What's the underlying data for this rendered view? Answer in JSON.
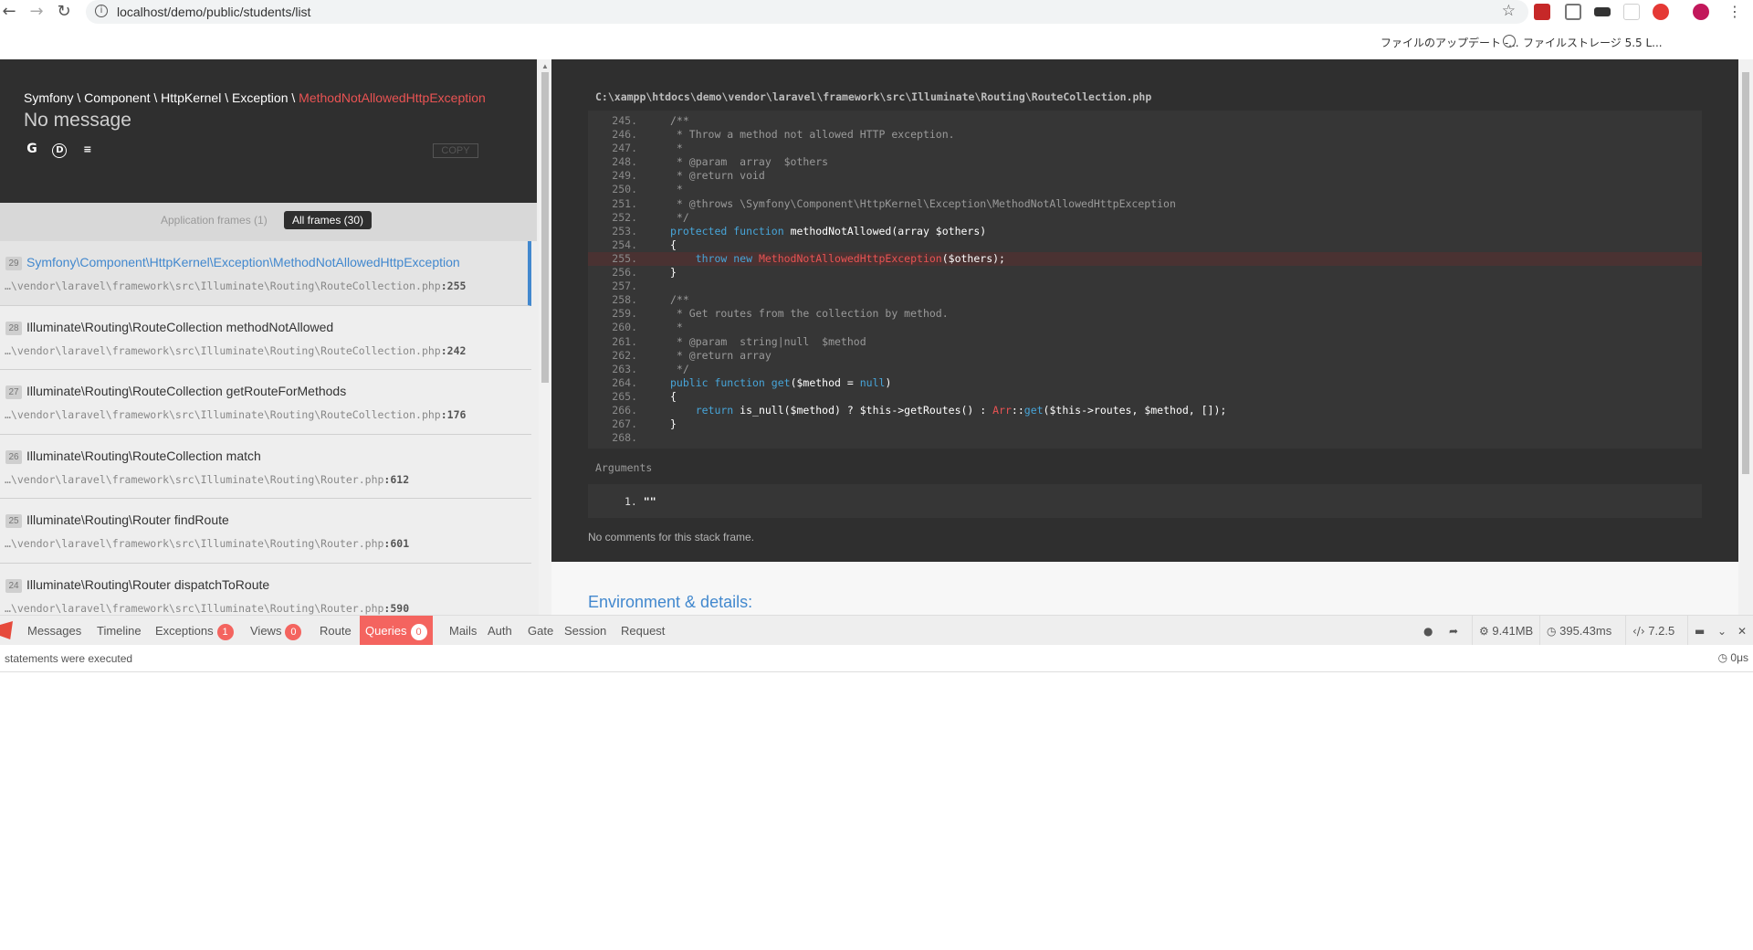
{
  "browser": {
    "url": "localhost/demo/public/students/list",
    "bookmarks": [
      "ファイルのアップデート -...",
      "ファイルストレージ 5.5 L..."
    ],
    "ext_colors": [
      "#c62828",
      "#777777",
      "#333333",
      "#cfcfcf",
      "#e53935",
      "#c2185b"
    ]
  },
  "exception": {
    "namespace": "Symfony \\ Component \\ HttpKernel \\ Exception \\ ",
    "class": "MethodNotAllowedHttpException",
    "message": "No message",
    "copy_label": "COPY",
    "icons": [
      "google-icon",
      "duckduckgo-icon",
      "stackoverflow-icon"
    ]
  },
  "tabs": {
    "app_frames": "Application frames (1)",
    "all_frames": "All frames (30)"
  },
  "frames": [
    {
      "idx": "29",
      "cls": "Symfony\\Component\\HttpKernel\\Exception\\MethodNotAllowedHttpException",
      "file": "…\\vendor\\laravel\\framework\\src\\Illuminate\\Routing\\RouteCollection.php",
      "line": ":255",
      "active": true
    },
    {
      "idx": "28",
      "cls": "Illuminate\\Routing\\RouteCollection methodNotAllowed",
      "file": "…\\vendor\\laravel\\framework\\src\\Illuminate\\Routing\\RouteCollection.php",
      "line": ":242",
      "active": false
    },
    {
      "idx": "27",
      "cls": "Illuminate\\Routing\\RouteCollection getRouteForMethods",
      "file": "…\\vendor\\laravel\\framework\\src\\Illuminate\\Routing\\RouteCollection.php",
      "line": ":176",
      "active": false
    },
    {
      "idx": "26",
      "cls": "Illuminate\\Routing\\RouteCollection match",
      "file": "…\\vendor\\laravel\\framework\\src\\Illuminate\\Routing\\Router.php",
      "line": ":612",
      "active": false
    },
    {
      "idx": "25",
      "cls": "Illuminate\\Routing\\Router findRoute",
      "file": "…\\vendor\\laravel\\framework\\src\\Illuminate\\Routing\\Router.php",
      "line": ":601",
      "active": false
    },
    {
      "idx": "24",
      "cls": "Illuminate\\Routing\\Router dispatchToRoute",
      "file": "…\\vendor\\laravel\\framework\\src\\Illuminate\\Routing\\Router.php",
      "line": ":590",
      "active": false
    }
  ],
  "code": {
    "file_path": "C:\\xampp\\htdocs\\demo\\vendor\\laravel\\framework\\src\\Illuminate\\Routing\\RouteCollection.php",
    "highlight_line": "255.",
    "lines": [
      {
        "n": "245.",
        "parts": [
          {
            "t": "/**",
            "c": "com"
          }
        ]
      },
      {
        "n": "246.",
        "parts": [
          {
            "t": " * Throw a method not allowed HTTP exception.",
            "c": "com"
          }
        ]
      },
      {
        "n": "247.",
        "parts": [
          {
            "t": " *",
            "c": "com"
          }
        ]
      },
      {
        "n": "248.",
        "parts": [
          {
            "t": " * @param  array  $others",
            "c": "com"
          }
        ]
      },
      {
        "n": "249.",
        "parts": [
          {
            "t": " * @return void",
            "c": "com"
          }
        ]
      },
      {
        "n": "250.",
        "parts": [
          {
            "t": " *",
            "c": "com"
          }
        ]
      },
      {
        "n": "251.",
        "parts": [
          {
            "t": " * @throws \\Symfony\\Component\\HttpKernel\\Exception\\MethodNotAllowedHttpException",
            "c": "com"
          }
        ]
      },
      {
        "n": "252.",
        "parts": [
          {
            "t": " */",
            "c": "com"
          }
        ]
      },
      {
        "n": "253.",
        "parts": [
          {
            "t": "protected function ",
            "c": "kw"
          },
          {
            "t": "methodNotAllowed(array $others)",
            "c": "fn"
          }
        ]
      },
      {
        "n": "254.",
        "parts": [
          {
            "t": "{",
            "c": "fn"
          }
        ]
      },
      {
        "n": "255.",
        "parts": [
          {
            "t": "    throw new ",
            "c": "kw"
          },
          {
            "t": "MethodNotAllowedHttpException",
            "c": "ex"
          },
          {
            "t": "($others);",
            "c": "fn"
          }
        ]
      },
      {
        "n": "256.",
        "parts": [
          {
            "t": "}",
            "c": "fn"
          }
        ]
      },
      {
        "n": "257.",
        "parts": []
      },
      {
        "n": "258.",
        "parts": [
          {
            "t": "/**",
            "c": "com"
          }
        ]
      },
      {
        "n": "259.",
        "parts": [
          {
            "t": " * Get routes from the collection by method.",
            "c": "com"
          }
        ]
      },
      {
        "n": "260.",
        "parts": [
          {
            "t": " *",
            "c": "com"
          }
        ]
      },
      {
        "n": "261.",
        "parts": [
          {
            "t": " * @param  string|null  $method",
            "c": "com"
          }
        ]
      },
      {
        "n": "262.",
        "parts": [
          {
            "t": " * @return array",
            "c": "com"
          }
        ]
      },
      {
        "n": "263.",
        "parts": [
          {
            "t": " */",
            "c": "com"
          }
        ]
      },
      {
        "n": "264.",
        "parts": [
          {
            "t": "public function ",
            "c": "kw"
          },
          {
            "t": "get",
            "c": "kw"
          },
          {
            "t": "($method = ",
            "c": "fn"
          },
          {
            "t": "null",
            "c": "kw"
          },
          {
            "t": ")",
            "c": "fn"
          }
        ]
      },
      {
        "n": "265.",
        "parts": [
          {
            "t": "{",
            "c": "fn"
          }
        ]
      },
      {
        "n": "266.",
        "parts": [
          {
            "t": "    return ",
            "c": "kw"
          },
          {
            "t": "is_null($method) ? $this->getRoutes() : ",
            "c": "fn"
          },
          {
            "t": "Arr",
            "c": "ex"
          },
          {
            "t": "::",
            "c": "fn"
          },
          {
            "t": "get",
            "c": "kw"
          },
          {
            "t": "($this->routes, $method, []);",
            "c": "fn"
          }
        ]
      },
      {
        "n": "267.",
        "parts": [
          {
            "t": "}",
            "c": "fn"
          }
        ]
      },
      {
        "n": "268.",
        "parts": []
      }
    ],
    "arguments_title": "Arguments",
    "argument_index": "1.",
    "argument_value": "\"\"",
    "no_comments": "No comments for this stack frame."
  },
  "environment_title": "Environment & details:",
  "debugbar": {
    "tabs": [
      {
        "label": "Messages",
        "badge": null,
        "active": false
      },
      {
        "label": "Timeline",
        "badge": null,
        "active": false
      },
      {
        "label": "Exceptions",
        "badge": "1",
        "active": false
      },
      {
        "label": "Views",
        "badge": "0",
        "active": false
      },
      {
        "label": "Route",
        "badge": null,
        "active": false
      },
      {
        "label": "Queries",
        "badge": "0",
        "active": true
      },
      {
        "label": "Mails",
        "badge": null,
        "active": false
      },
      {
        "label": "Auth",
        "badge": null,
        "active": false
      },
      {
        "label": "Gate",
        "badge": null,
        "active": false
      },
      {
        "label": "Session",
        "badge": null,
        "active": false
      },
      {
        "label": "Request",
        "badge": null,
        "active": false
      }
    ],
    "memory": "9.41MB",
    "time": "395.43ms",
    "php_version": "7.2.5",
    "panel_text": "statements were executed",
    "panel_time": "0μs"
  }
}
